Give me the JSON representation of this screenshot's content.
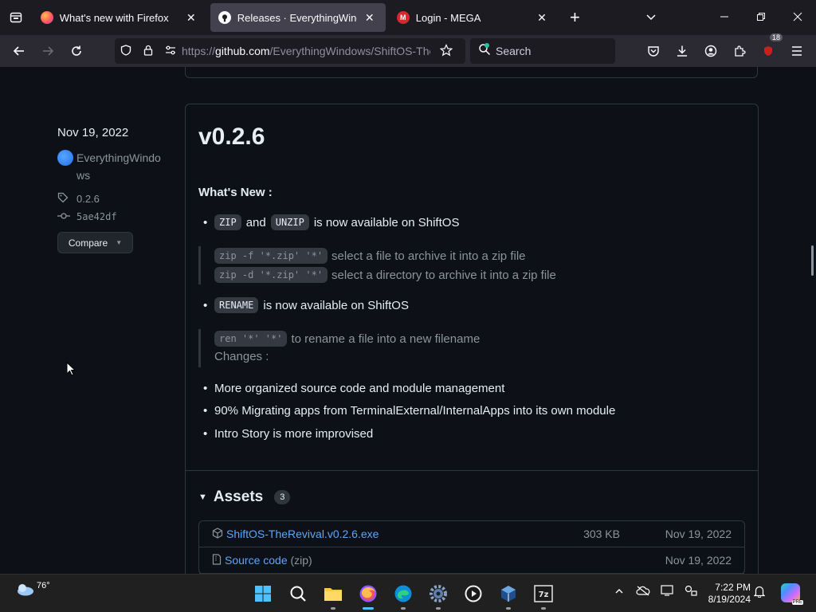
{
  "browser": {
    "tabs": [
      {
        "label": "What's new with Firefox",
        "icon": "firefox-icon",
        "active": false
      },
      {
        "label": "Releases · EverythingWindows/ShiftOS-TheRevival",
        "icon": "github-icon",
        "active": true
      },
      {
        "label": "Login - MEGA",
        "icon": "mega-icon",
        "active": false
      }
    ],
    "close_glyph": "✕",
    "new_tab_glyph": "+",
    "url_prefix": "https://",
    "url_host": "github.com",
    "url_path": "/EverythingWindows/ShiftOS-TheRevival/releases",
    "search_placeholder": "Search",
    "extension_badge": "18"
  },
  "sidebar": {
    "date": "Nov 19, 2022",
    "author": "EverythingWindows",
    "tag": "0.2.6",
    "commit": "5ae42df",
    "compare_label": "Compare"
  },
  "release": {
    "title": "v0.2.6",
    "whats_new": "What's New :",
    "zip_code": "ZIP",
    "and": "and",
    "unzip_code": "UNZIP",
    "zip_text": "is now available on ShiftOS",
    "zip_cmd_1": "zip -f '*.zip' '*'",
    "zip_desc_1": "select a file to archive it into a zip file",
    "zip_cmd_2": "zip -d '*.zip' '*'",
    "zip_desc_2": "select a directory to archive it into a zip file",
    "rename_code": "RENAME",
    "rename_text": "is now available on ShiftOS",
    "ren_cmd": "ren '*' '*'",
    "ren_desc": "to rename a file into a new filename",
    "changes": "Changes :",
    "change_items": [
      "More organized source code and module management",
      "90% Migrating apps from TerminalExternal/InternalApps into its own module",
      "Intro Story is more improvised"
    ]
  },
  "assets": {
    "label": "Assets",
    "count": "3",
    "rows": [
      {
        "name": "ShiftOS-TheRevival.v0.2.6.exe",
        "sub": "",
        "size": "303 KB",
        "date": "Nov 19, 2022",
        "icon": "package-icon"
      },
      {
        "name": "Source code",
        "sub": "(zip)",
        "size": "",
        "date": "Nov 19, 2022",
        "icon": "file-zip-icon"
      }
    ]
  },
  "taskbar": {
    "temperature": "76°",
    "time": "7:22 PM",
    "date": "8/19/2024",
    "pinned": [
      "windows-start-icon",
      "search-icon",
      "file-explorer-icon",
      "firefox-icon",
      "edge-icon",
      "settings-icon",
      "media-player-icon",
      "virtualbox-icon",
      "7zip-icon"
    ],
    "copilot_badge": "PRE"
  },
  "colors": {
    "page_bg": "#0d1117",
    "link": "#58a6ff",
    "muted": "#8b949e",
    "border": "#30363d"
  }
}
